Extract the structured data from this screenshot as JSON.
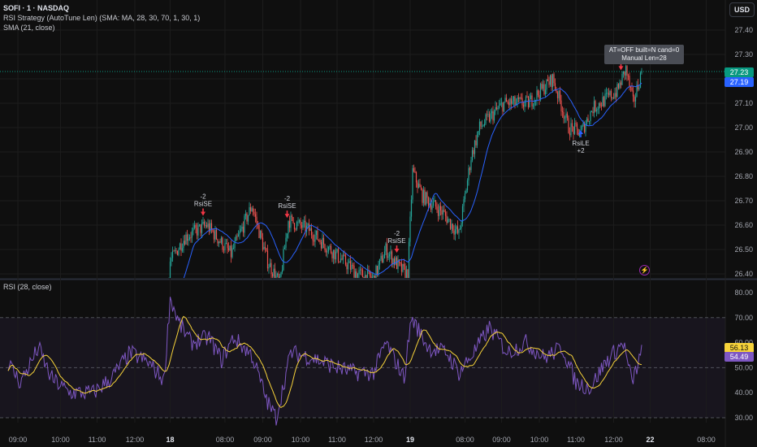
{
  "header": {
    "symbol": "SOFI · 1 · NASDAQ",
    "strategy": "RSI Strategy (AutoTune Len) (SMA: MA, 28, 30, 70, 1, 30, 1)",
    "sma": "SMA (21, close)",
    "currency": "USD"
  },
  "tooltip": {
    "line1": "AT=OFF built=N cand=0",
    "line2": "Manual Len=28"
  },
  "price_tags": {
    "last": "27.23",
    "sma": "27.19",
    "last_color": "#089981",
    "sma_color": "#2962ff"
  },
  "rsi_pane": {
    "title": "RSI (28, close)",
    "tag_ma": "56.13",
    "tag_rsi": "54.49",
    "ma_color": "#f7d33a",
    "rsi_color": "#7e57c2"
  },
  "chart_data": {
    "type": "candlestick",
    "price_axis": {
      "ticks": [
        "27.40",
        "27.30",
        "27.20",
        "27.10",
        "27.00",
        "26.90",
        "26.80",
        "26.70",
        "26.60",
        "26.50",
        "26.40"
      ],
      "range": [
        26.37,
        27.42
      ]
    },
    "rsi_axis": {
      "ticks": [
        "80.00",
        "70.00",
        "60.00",
        "50.00",
        "40.00",
        "30.00"
      ],
      "range": [
        28,
        82
      ],
      "bands": [
        70,
        50,
        30
      ]
    },
    "time_axis": [
      {
        "label": "09:00",
        "bar": 8
      },
      {
        "label": "10:00",
        "bar": 43
      },
      {
        "label": "11:00",
        "bar": 73
      },
      {
        "label": "12:00",
        "bar": 104
      },
      {
        "label": "18",
        "bar": 133,
        "bold": true
      },
      {
        "label": "08:00",
        "bar": 178
      },
      {
        "label": "09:00",
        "bar": 209
      },
      {
        "label": "10:00",
        "bar": 240
      },
      {
        "label": "11:00",
        "bar": 270
      },
      {
        "label": "12:00",
        "bar": 300
      },
      {
        "label": "19",
        "bar": 330,
        "bold": true
      },
      {
        "label": "08:00",
        "bar": 375
      },
      {
        "label": "09:00",
        "bar": 405
      },
      {
        "label": "10:00",
        "bar": 436
      },
      {
        "label": "11:00",
        "bar": 466
      },
      {
        "label": "12:00",
        "bar": 497
      },
      {
        "label": "22",
        "bar": 527,
        "bold": true
      },
      {
        "label": "08:00",
        "bar": 573
      }
    ],
    "price_waypoints": [
      [
        0,
        26.2
      ],
      [
        130,
        26.2
      ],
      [
        133,
        26.45
      ],
      [
        145,
        26.55
      ],
      [
        163,
        26.6
      ],
      [
        183,
        26.48
      ],
      [
        200,
        26.68
      ],
      [
        213,
        26.45
      ],
      [
        223,
        26.36
      ],
      [
        230,
        26.62
      ],
      [
        247,
        26.58
      ],
      [
        260,
        26.52
      ],
      [
        287,
        26.4
      ],
      [
        300,
        26.38
      ],
      [
        310,
        26.5
      ],
      [
        322,
        26.42
      ],
      [
        328,
        26.4
      ],
      [
        332,
        26.82
      ],
      [
        340,
        26.72
      ],
      [
        357,
        26.65
      ],
      [
        370,
        26.56
      ],
      [
        380,
        26.88
      ],
      [
        387,
        27.0
      ],
      [
        407,
        27.1
      ],
      [
        427,
        27.1
      ],
      [
        447,
        27.2
      ],
      [
        460,
        27.0
      ],
      [
        470,
        26.98
      ],
      [
        480,
        27.08
      ],
      [
        500,
        27.15
      ],
      [
        507,
        27.24
      ],
      [
        513,
        27.1
      ],
      [
        520,
        27.23
      ]
    ],
    "rsi_waypoints": [
      [
        0,
        52
      ],
      [
        10,
        44
      ],
      [
        25,
        58
      ],
      [
        35,
        46
      ],
      [
        50,
        40
      ],
      [
        70,
        40
      ],
      [
        85,
        46
      ],
      [
        100,
        56
      ],
      [
        115,
        52
      ],
      [
        128,
        45
      ],
      [
        133,
        78
      ],
      [
        140,
        68
      ],
      [
        150,
        60
      ],
      [
        165,
        62
      ],
      [
        175,
        53
      ],
      [
        185,
        62
      ],
      [
        200,
        55
      ],
      [
        213,
        36
      ],
      [
        220,
        30
      ],
      [
        232,
        56
      ],
      [
        250,
        54
      ],
      [
        270,
        50
      ],
      [
        285,
        48
      ],
      [
        300,
        48
      ],
      [
        310,
        60
      ],
      [
        325,
        46
      ],
      [
        331,
        70
      ],
      [
        345,
        58
      ],
      [
        360,
        56
      ],
      [
        370,
        48
      ],
      [
        385,
        58
      ],
      [
        395,
        66
      ],
      [
        410,
        56
      ],
      [
        425,
        60
      ],
      [
        440,
        54
      ],
      [
        455,
        58
      ],
      [
        466,
        44
      ],
      [
        478,
        42
      ],
      [
        490,
        52
      ],
      [
        505,
        60
      ],
      [
        512,
        44
      ],
      [
        520,
        56
      ]
    ],
    "signals": [
      {
        "bar": 160,
        "type": "short",
        "label": "RsiSE",
        "qty": "-2"
      },
      {
        "bar": 229,
        "type": "short",
        "label": "RsiSE",
        "qty": "-2"
      },
      {
        "bar": 319,
        "type": "short",
        "label": "RsiSE",
        "qty": "-2"
      },
      {
        "bar": 503,
        "type": "short",
        "label": "RsiSE",
        "qty": "-2"
      },
      {
        "bar": 470,
        "type": "long",
        "label": "RsiLE",
        "qty": "+2"
      }
    ]
  }
}
